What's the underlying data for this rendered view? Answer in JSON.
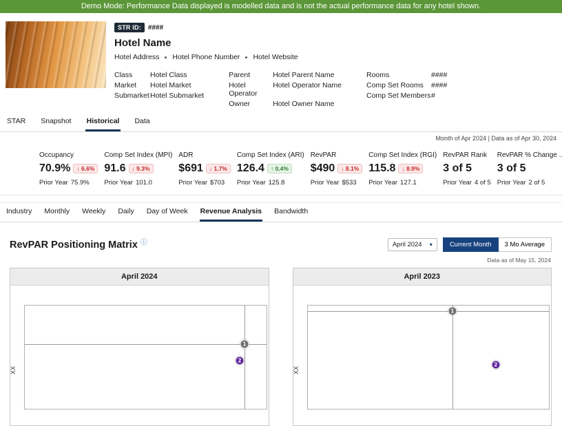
{
  "banner": {
    "text": "Demo Mode: Performance Data displayed is modelled data and is not the actual performance data for any hotel shown."
  },
  "icons": {
    "info": "ⓘ",
    "caret": "▾"
  },
  "hotel": {
    "str_id_label": "STR ID:",
    "str_id_value": "####",
    "name": "Hotel Name",
    "address": "Hotel Address",
    "phone": "Hotel Phone Number",
    "website": "Hotel Website",
    "details": [
      {
        "label": "Class",
        "value": "Hotel Class"
      },
      {
        "label": "Market",
        "value": "Hotel Market"
      },
      {
        "label": "Submarket",
        "value": "Hotel Submarket"
      },
      {
        "label": "Parent",
        "value": "Hotel Parent Name"
      },
      {
        "label": "Hotel Operator",
        "value": "Hotel Operator Name"
      },
      {
        "label": "Owner",
        "value": "Hotel Owner Name"
      },
      {
        "label": "Rooms",
        "value": "####"
      },
      {
        "label": "Comp Set Rooms",
        "value": "####"
      },
      {
        "label": "Comp Set Members",
        "value": "#"
      }
    ]
  },
  "primary_tabs": [
    {
      "label": "STAR"
    },
    {
      "label": "Snapshot"
    },
    {
      "label": "Historical"
    },
    {
      "label": "Data"
    }
  ],
  "period_info": "Month of Apr 2024 | Data as of Apr 30, 2024",
  "kpi_prior_label": "Prior Year",
  "kpis": [
    {
      "label": "Occupancy",
      "value": "70.9%",
      "arrow": "↓",
      "change": "6.6%",
      "prior": "75.9%"
    },
    {
      "label": "Comp Set Index (MPI)",
      "value": "91.6",
      "arrow": "↓",
      "change": "9.3%",
      "prior": "101.0"
    },
    {
      "label": "ADR",
      "value": "$691",
      "arrow": "↓",
      "change": "1.7%",
      "prior": "$703"
    },
    {
      "label": "Comp Set Index (ARI)",
      "value": "126.4",
      "arrow": "↑",
      "change": "0.4%",
      "prior": "125.8"
    },
    {
      "label": "RevPAR",
      "value": "$490",
      "arrow": "↓",
      "change": "8.1%",
      "prior": "$533"
    },
    {
      "label": "Comp Set Index (RGI)",
      "value": "115.8",
      "arrow": "↓",
      "change": "8.9%",
      "prior": "127.1"
    },
    {
      "label": "RevPAR Rank",
      "value": "3 of 5",
      "prior": "4 of 5"
    },
    {
      "label": "RevPAR % Change ...",
      "value": "3 of 5",
      "prior": "2 of 5"
    }
  ],
  "secondary_tabs": [
    {
      "label": "Industry"
    },
    {
      "label": "Monthly"
    },
    {
      "label": "Weekly"
    },
    {
      "label": "Daily"
    },
    {
      "label": "Day of Week"
    },
    {
      "label": "Revenue Analysis"
    },
    {
      "label": "Bandwidth"
    }
  ],
  "matrix": {
    "title": "RevPAR Positioning Matrix",
    "month_value": "April 2024",
    "toggle_current": "Current Month",
    "toggle_average": "3 Mo Average",
    "data_as_of": "Data as of May 15, 2024"
  },
  "colors": {
    "banner_green": "#5b9638",
    "accent_navy": "#17427e",
    "down_red": "#c62828",
    "up_green": "#2e7d32",
    "marker_subject": "#6d6e71",
    "marker_compset": "#5f259f"
  },
  "chart_data": [
    {
      "type": "scatter",
      "title": "April 2024",
      "ylabel": "XX",
      "crosshair_point": 0,
      "points": [
        {
          "label": "1",
          "x_pct": 91,
          "y_pct": 37,
          "color": "#6d6e71"
        },
        {
          "label": "2",
          "x_pct": 89,
          "y_pct": 53,
          "color": "#5f259f"
        }
      ]
    },
    {
      "type": "scatter",
      "title": "April 2023",
      "ylabel": "XX",
      "crosshair_point": 0,
      "points": [
        {
          "label": "1",
          "x_pct": 60,
          "y_pct": 5,
          "color": "#6d6e71"
        },
        {
          "label": "2",
          "x_pct": 78,
          "y_pct": 57,
          "color": "#5f259f"
        }
      ]
    }
  ]
}
